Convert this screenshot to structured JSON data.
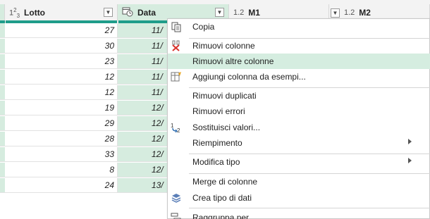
{
  "columns": [
    {
      "type_label": "1²₃",
      "name": "Lotto"
    },
    {
      "type_label": "",
      "name": "Data"
    },
    {
      "type_label": "1.2",
      "name": "M1"
    },
    {
      "type_label": "1.2",
      "name": "M2"
    }
  ],
  "rows": [
    {
      "lotto": "27",
      "data": "11/"
    },
    {
      "lotto": "30",
      "data": "11/"
    },
    {
      "lotto": "23",
      "data": "11/"
    },
    {
      "lotto": "12",
      "data": "11/"
    },
    {
      "lotto": "12",
      "data": "11/"
    },
    {
      "lotto": "19",
      "data": "12/"
    },
    {
      "lotto": "29",
      "data": "12/"
    },
    {
      "lotto": "28",
      "data": "12/"
    },
    {
      "lotto": "33",
      "data": "12/"
    },
    {
      "lotto": "8",
      "data": "12/"
    },
    {
      "lotto": "24",
      "data": "13/"
    }
  ],
  "menu": {
    "items": [
      {
        "label": "Copia",
        "icon": "copy-icon"
      },
      {
        "label": "Rimuovi colonne",
        "icon": "remove-columns-icon"
      },
      {
        "label": "Rimuovi altre colonne",
        "icon": "",
        "highlighted": true
      },
      {
        "label": "Aggiungi colonna da esempi...",
        "icon": "add-column-from-examples-icon"
      },
      {
        "label": "Rimuovi duplicati",
        "icon": ""
      },
      {
        "label": "Rimuovi errori",
        "icon": ""
      },
      {
        "label": "Sostituisci valori...",
        "icon": "replace-values-icon"
      },
      {
        "label": "Riempimento",
        "icon": "",
        "submenu": true
      },
      {
        "label": "Modifica tipo",
        "icon": "",
        "submenu": true
      },
      {
        "label": "Merge di colonne",
        "icon": ""
      },
      {
        "label": "Crea tipo di dati",
        "icon": "create-data-type-icon"
      },
      {
        "label": "Raggruppa per...",
        "icon": "group-by-icon"
      }
    ]
  },
  "colors": {
    "accent": "#1f9d8a",
    "selection": "#d6ecdf",
    "menu_highlight": "#d5ede0"
  }
}
